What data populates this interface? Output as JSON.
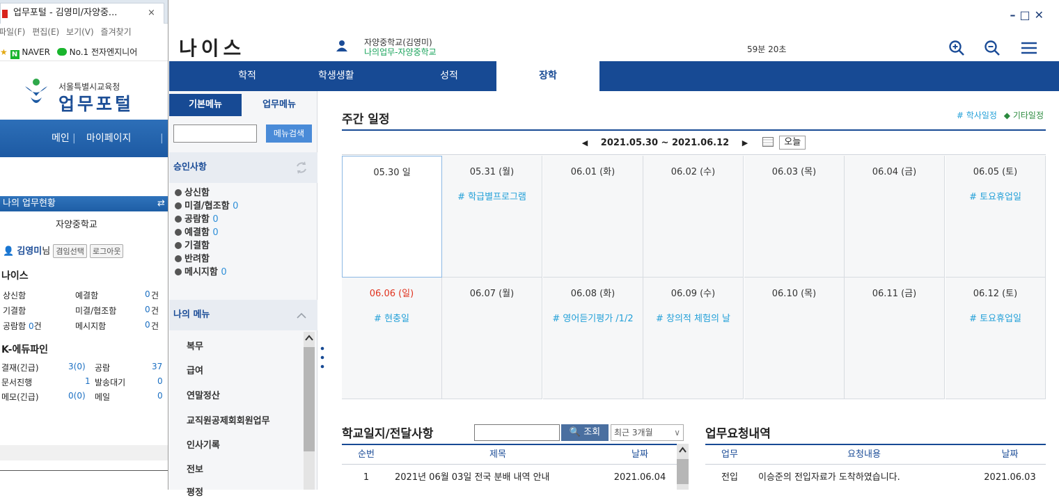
{
  "left_browser": {
    "tab_title": "업무포털 - 김영미/자양중...",
    "tab_close": "×",
    "menu": [
      "파일(F)",
      "편집(E)",
      "보기(V)",
      "즐겨찾기"
    ],
    "favorites": [
      "NAVER",
      "No.1 전자엔지니어"
    ],
    "logo_org": "서울특별시교육청",
    "logo_title": "업무포털",
    "nav": [
      "메인",
      "마이페이지"
    ],
    "section_title": "나의 업무현황",
    "school": "자양중학교",
    "user_name": "김영미",
    "user_suffix": "님",
    "btn_position": "겸임선택",
    "btn_logout": "로그아웃",
    "neis_title": "나이스",
    "neis_rows": [
      {
        "a": "상신함",
        "b": "예결함",
        "bv": "0",
        "unit": "건"
      },
      {
        "a": "기결함",
        "b": "미결/협조함",
        "bv": "0",
        "unit": "건"
      },
      {
        "a": "공람함",
        "av": "0",
        "aunit": "건",
        "b": "메시지함",
        "bv": "0",
        "unit": "건"
      }
    ],
    "edu_title": "K-에듀파인",
    "edu_rows": [
      {
        "a": "결재(긴급)",
        "av": "3(0)",
        "b": "공람",
        "bv": "37"
      },
      {
        "a": "문서진행",
        "av": "1",
        "b": "발송대기",
        "bv": "0"
      },
      {
        "a": "메모(긴급)",
        "av": "0(0)",
        "b": "메일",
        "bv": "0"
      }
    ]
  },
  "app": {
    "window_controls": "–□✕",
    "title": "나이스",
    "user_school": "자양중학교(김영미)",
    "user_role": "나의업무-자양중학교",
    "timer": "59분 20초",
    "nav": [
      "학적",
      "학생생활",
      "성적",
      "장학"
    ],
    "active_nav": "장학",
    "left_menu": {
      "tab_basic": "기본메뉴",
      "tab_work": "업무메뉴",
      "search_btn": "메뉴검색",
      "search_value": "",
      "approval_title": "승인사항",
      "approval_items": [
        {
          "label": "상신함",
          "count": ""
        },
        {
          "label": "미결/협조함",
          "count": "0"
        },
        {
          "label": "공람함",
          "count": "0"
        },
        {
          "label": "예결함",
          "count": "0"
        },
        {
          "label": "기결함",
          "count": ""
        },
        {
          "label": "반려함",
          "count": ""
        },
        {
          "label": "메시지함",
          "count": "0"
        }
      ],
      "my_menu_title": "나의 메뉴",
      "my_menu": [
        "복무",
        "급여",
        "연말정산",
        "교직원공제회회원업무",
        "인사기록",
        "전보",
        "평정"
      ]
    },
    "weekly": {
      "title": "주간 일정",
      "legend_a": "# 학사일정",
      "legend_b": "◆ 기타일정",
      "range": "2021.05.30 ~ 2021.06.12",
      "today_btn": "오늘",
      "days": [
        {
          "date": "05.30 일",
          "event": "",
          "sunday": false,
          "today": true
        },
        {
          "date": "05.31 (월)",
          "event": "# 학급별프로그램",
          "sunday": false,
          "today": false
        },
        {
          "date": "06.01 (화)",
          "event": "",
          "sunday": false,
          "today": false
        },
        {
          "date": "06.02 (수)",
          "event": "",
          "sunday": false,
          "today": false
        },
        {
          "date": "06.03 (목)",
          "event": "",
          "sunday": false,
          "today": false
        },
        {
          "date": "06.04 (금)",
          "event": "",
          "sunday": false,
          "today": false
        },
        {
          "date": "06.05 (토)",
          "event": "# 토요휴업일",
          "sunday": false,
          "today": false
        },
        {
          "date": "06.06 (일)",
          "event": "# 현충일",
          "sunday": true,
          "today": false
        },
        {
          "date": "06.07 (월)",
          "event": "",
          "sunday": false,
          "today": false
        },
        {
          "date": "06.08 (화)",
          "event": "# 영어듣기평가 /1/2",
          "sunday": false,
          "today": false
        },
        {
          "date": "06.09 (수)",
          "event": "# 창의적 체험의 날",
          "sunday": false,
          "today": false
        },
        {
          "date": "06.10 (목)",
          "event": "",
          "sunday": false,
          "today": false
        },
        {
          "date": "06.11 (금)",
          "event": "",
          "sunday": false,
          "today": false
        },
        {
          "date": "06.12 (토)",
          "event": "# 토요휴업일",
          "sunday": false,
          "today": false
        }
      ]
    },
    "journal": {
      "title": "학교일지/전달사항",
      "search_btn": "조회",
      "period": "최근 3개월",
      "headers": [
        "순번",
        "제목",
        "날짜"
      ],
      "rows": [
        {
          "no": "1",
          "title": "2021년 06월 03일 전국 분배 내역 안내",
          "date": "2021.06.04"
        }
      ]
    },
    "requests": {
      "title": "업무요청내역",
      "headers": [
        "업무",
        "요청내용",
        "날짜"
      ],
      "rows": [
        {
          "type": "전입",
          "content": "이승준의 전입자료가 도착하였습니다.",
          "date": "2021.06.03"
        }
      ]
    }
  }
}
